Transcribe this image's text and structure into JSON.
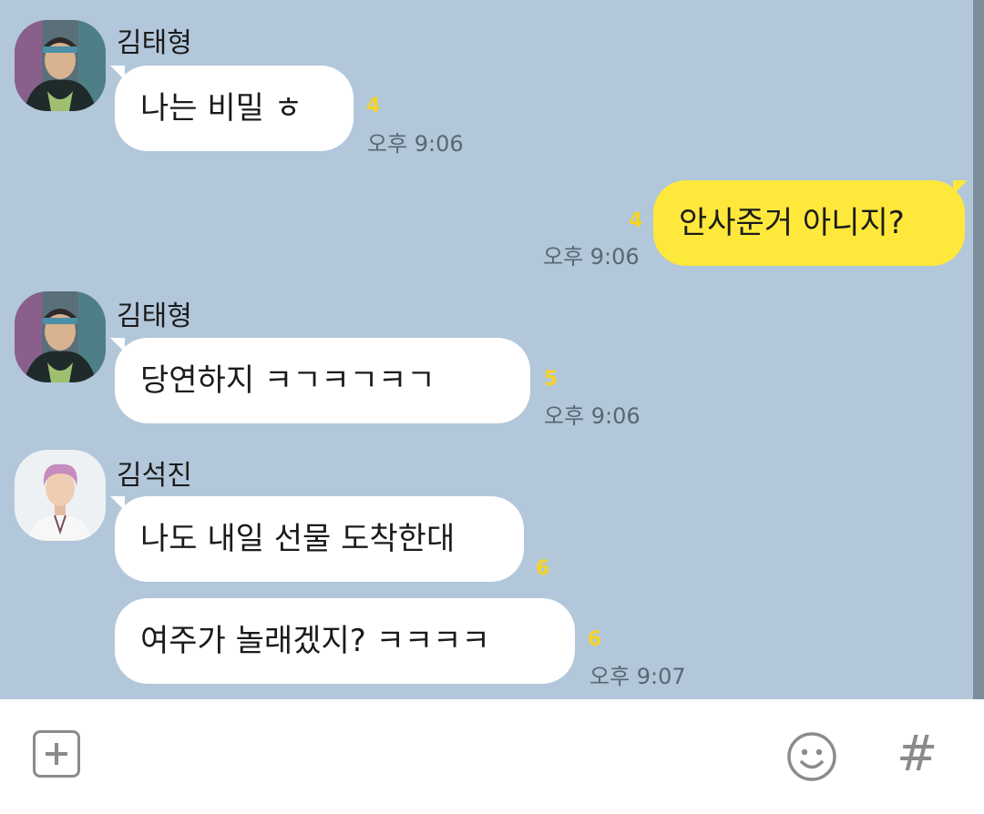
{
  "messages": [
    {
      "sender": "김태형",
      "text": "나는 비밀 ㅎ",
      "unread": "4",
      "time": "오후 9:06",
      "mine": false
    },
    {
      "sender": "",
      "text": "안사준거 아니지?",
      "unread": "4",
      "time": "오후 9:06",
      "mine": true
    },
    {
      "sender": "김태형",
      "text": "당연하지 ㅋㄱㅋㄱㅋㄱ",
      "unread": "5",
      "time": "오후 9:06",
      "mine": false
    },
    {
      "sender": "김석진",
      "text": "나도 내일 선물 도착한대",
      "unread": "6",
      "time": "",
      "mine": false
    },
    {
      "sender": "김석진",
      "text": "여주가 놀래겠지? ㅋㅋㅋㅋ",
      "unread": "6",
      "time": "오후 9:07",
      "mine": false
    }
  ],
  "input_bar": {
    "plus_icon": "plus-icon",
    "emoji_icon": "emoji-icon",
    "hash_label": "#"
  },
  "colors": {
    "chat_background": "#b2c7da",
    "my_bubble": "#fee83b",
    "their_bubble": "#ffffff",
    "unread_count": "#f5d328",
    "icon_gray": "#8b8b8b"
  }
}
